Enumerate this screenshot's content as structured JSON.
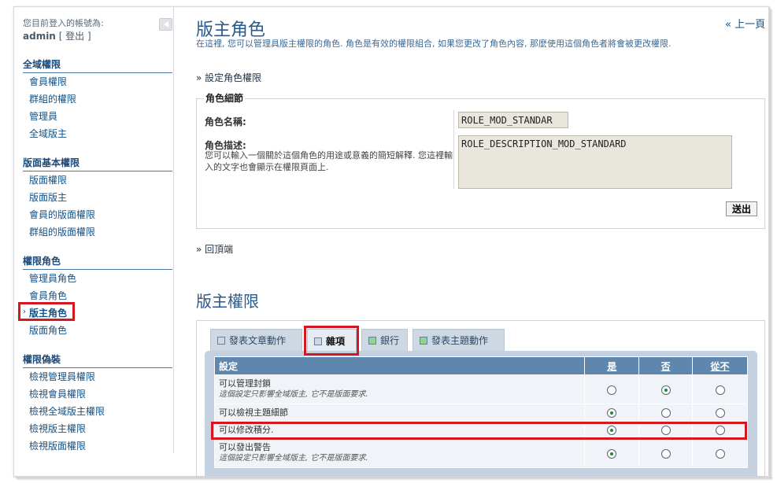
{
  "sidebar": {
    "login_label": "您目前登入的帳號為:",
    "user": "admin",
    "logout": "[ 登出 ]",
    "sections": [
      {
        "title": "全域權限",
        "items": [
          "會員權限",
          "群組的權限",
          "管理員",
          "全域版主"
        ]
      },
      {
        "title": "版面基本權限",
        "items": [
          "版面權限",
          "版面版主",
          "會員的版面權限",
          "群組的版面權限"
        ]
      },
      {
        "title": "權限角色",
        "items": [
          "管理員角色",
          "會員角色",
          "版主角色",
          "版面角色"
        ]
      },
      {
        "title": "權限偽裝",
        "items": [
          "檢視管理員權限",
          "檢視會員權限",
          "檢視全域版主權限",
          "檢視版主權限",
          "檢視版面權限"
        ]
      }
    ]
  },
  "header": {
    "back_link": "« 上一頁",
    "title": "版主角色",
    "description": "在這裡, 您可以管理具版主權限的角色. 角色是有效的權限組合, 如果您更改了角色內容, 那麼使用這個角色者將會被更改權限."
  },
  "settings_link": "» 設定角色權限",
  "role_details": {
    "legend": "角色細節",
    "name_label": "角色名稱:",
    "name_value": "ROLE_MOD_STANDAR",
    "desc_label": "角色描述:",
    "desc_help": "您可以輸入一個關於這個角色的用途或意義的簡短解釋. 您這裡輸入的文字也會顯示在權限頁面上.",
    "desc_value": "ROLE_DESCRIPTION_MOD_STANDARD",
    "submit": "送出"
  },
  "back_top": "» 回頂端",
  "perm": {
    "title": "版主權限",
    "tabs": [
      {
        "label": "發表文章動作",
        "color": "#cdd8e3"
      },
      {
        "label": "雜項",
        "color": "#cdd8e3"
      },
      {
        "label": "銀行",
        "color": "#8fd48f"
      },
      {
        "label": "發表主題動作",
        "color": "#8fd48f"
      }
    ],
    "columns": [
      "設定",
      "是",
      "否",
      "從不"
    ],
    "rows": [
      {
        "label": "可以管理封鎖",
        "note": "這個設定只影響全域版主, 它不是版面要求.",
        "value": "no"
      },
      {
        "label": "可以檢視主題細節",
        "note": "",
        "value": "yes"
      },
      {
        "label": "可以修改積分.",
        "note": "",
        "value": "yes"
      },
      {
        "label": "可以發出警告",
        "note": "這個設定只影響全域版主, 它不是版面要求.",
        "value": "yes"
      }
    ]
  }
}
